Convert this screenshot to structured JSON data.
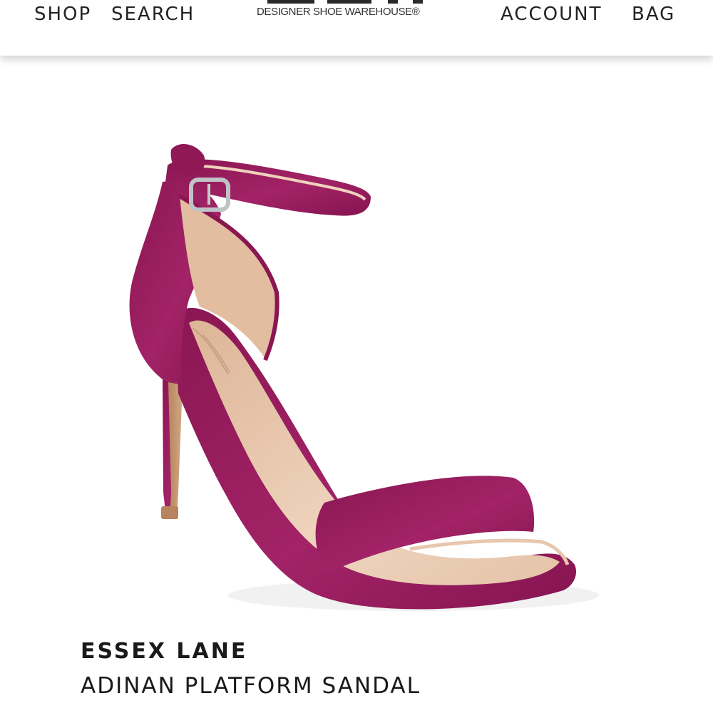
{
  "header": {
    "nav_left": [
      "SHOP",
      "SEARCH"
    ],
    "nav_right": [
      "ACCOUNT",
      "BAG"
    ],
    "logo_tagline": "DESIGNER SHOE WAREHOUSE®"
  },
  "product": {
    "brand": "ESSEX LANE",
    "name": "ADINAN PLATFORM SANDAL",
    "image_icon": "sandal-product-image",
    "colors": {
      "suede": "#9b1d5e",
      "insole": "#e9c7ab",
      "heel": "#c49a77"
    }
  }
}
